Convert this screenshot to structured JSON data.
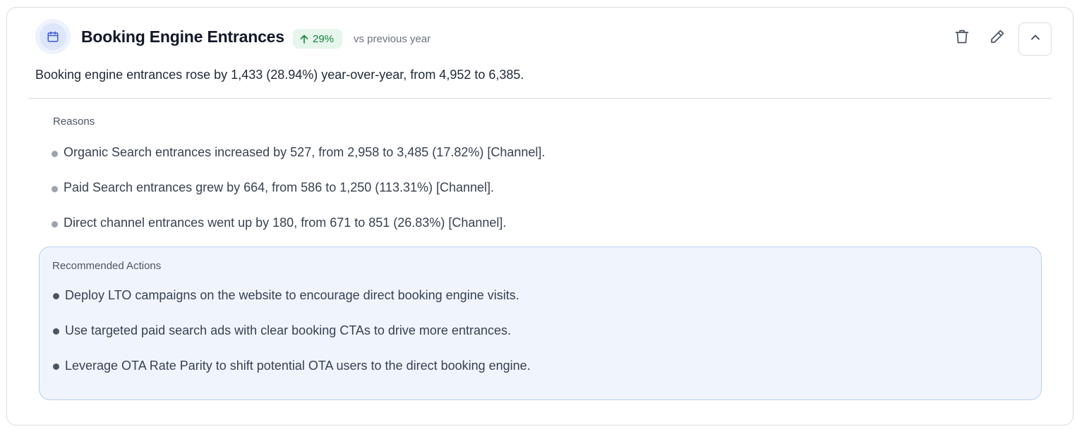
{
  "header": {
    "title": "Booking Engine Entrances",
    "icon": "calendar-icon",
    "badge": {
      "direction": "up",
      "value": "29%",
      "color": "#15803d",
      "background": "#e6f6ec"
    },
    "comparison_label": "vs previous year",
    "actions": {
      "delete_icon": "trash-icon",
      "edit_icon": "pencil-icon",
      "collapse_icon": "chevron-up-icon"
    }
  },
  "summary": "Booking engine entrances rose by 1,433 (28.94%) year-over-year, from 4,952 to 6,385.",
  "reasons": {
    "label": "Reasons",
    "items": [
      "Organic Search entrances increased by 527, from 2,958 to 3,485 (17.82%) [Channel].",
      "Paid Search entrances grew by 664, from 586 to 1,250 (113.31%) [Channel].",
      "Direct channel entrances went up by 180, from 671 to 851 (26.83%) [Channel]."
    ]
  },
  "recommended_actions": {
    "label": "Recommended Actions",
    "items": [
      "Deploy LTO campaigns on the website to encourage direct booking engine visits.",
      "Use targeted paid search ads with clear booking CTAs to drive more entrances.",
      "Leverage OTA Rate Parity to shift potential OTA users to the direct booking engine."
    ]
  },
  "colors": {
    "accent": "#3b5bdb",
    "positive": "#15803d",
    "actions_background": "#f0f5fd",
    "actions_border": "#b7cdef"
  }
}
